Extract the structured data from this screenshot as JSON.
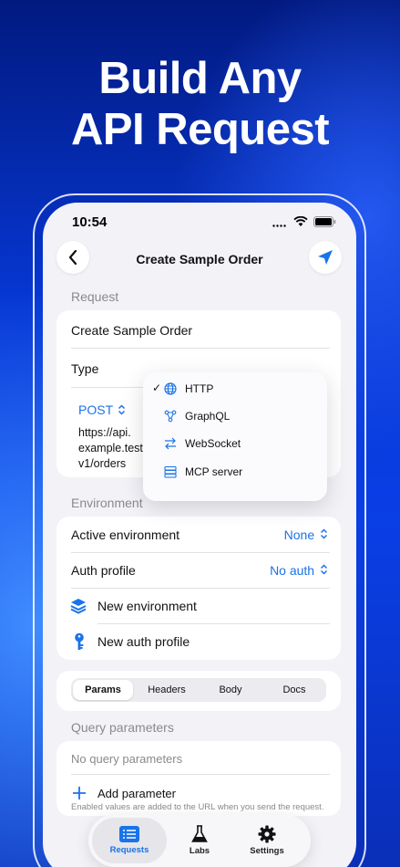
{
  "headline": {
    "line1": "Build Any",
    "line2": "API Request"
  },
  "status_bar": {
    "time": "10:54"
  },
  "nav": {
    "title": "Create Sample Order"
  },
  "request": {
    "section_title": "Request",
    "name": "Create Sample Order",
    "type_label": "Type",
    "method": "POST",
    "url_lines": [
      "https://api.",
      "example.test/",
      "v1/orders"
    ]
  },
  "type_menu": {
    "items": [
      {
        "label": "HTTP",
        "checked": true,
        "icon": "globe-icon"
      },
      {
        "label": "GraphQL",
        "checked": false,
        "icon": "graph-icon"
      },
      {
        "label": "WebSocket",
        "checked": false,
        "icon": "arrows-icon"
      },
      {
        "label": "MCP server",
        "checked": false,
        "icon": "server-icon"
      }
    ]
  },
  "environment": {
    "section_title": "Environment",
    "active_label": "Active environment",
    "active_value": "None",
    "auth_label": "Auth profile",
    "auth_value": "No auth",
    "new_env": "New environment",
    "new_auth": "New auth profile"
  },
  "segments": {
    "items": [
      "Params",
      "Headers",
      "Body",
      "Docs"
    ],
    "selected": "Params"
  },
  "query": {
    "section_title": "Query parameters",
    "empty": "No query parameters",
    "add": "Add parameter",
    "footnote": "Enabled values are added to the URL when you send the request."
  },
  "tabbar": {
    "items": [
      "Requests",
      "Labs",
      "Settings"
    ],
    "selected": "Requests"
  },
  "colors": {
    "accent": "#1a73e8",
    "background": "#0a3fe6"
  }
}
